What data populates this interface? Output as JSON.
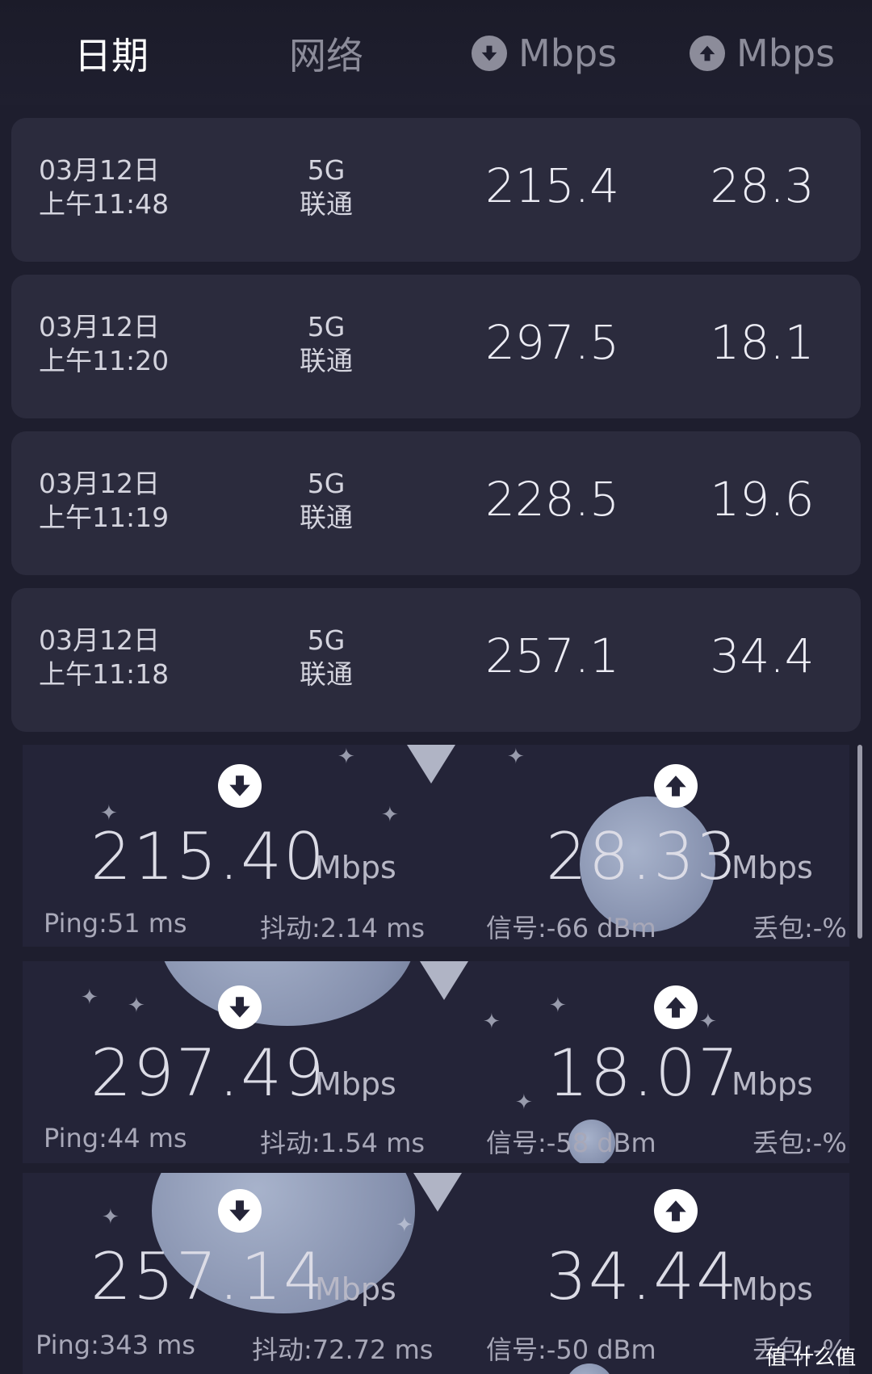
{
  "header": {
    "date_label": "日期",
    "network_label": "网络",
    "download_unit": "Mbps",
    "upload_unit": "Mbps"
  },
  "history": [
    {
      "date": "03月12日",
      "time": "上午11:48",
      "net_type": "5G",
      "carrier": "联通",
      "down": "215.4",
      "up": "28.3"
    },
    {
      "date": "03月12日",
      "time": "上午11:20",
      "net_type": "5G",
      "carrier": "联通",
      "down": "297.5",
      "up": "18.1"
    },
    {
      "date": "03月12日",
      "time": "上午11:19",
      "net_type": "5G",
      "carrier": "联通",
      "down": "228.5",
      "up": "19.6"
    },
    {
      "date": "03月12日",
      "time": "上午11:18",
      "net_type": "5G",
      "carrier": "联通",
      "down": "257.1",
      "up": "34.4"
    }
  ],
  "results": [
    {
      "down": "215.40",
      "up": "28.33",
      "unit": "Mbps",
      "ping": "Ping:51 ms",
      "jitter": "抖动:2.14 ms",
      "signal": "信号:-66 dBm",
      "loss": "丢包:-%"
    },
    {
      "down": "297.49",
      "up": "18.07",
      "unit": "Mbps",
      "ping": "Ping:44 ms",
      "jitter": "抖动:1.54 ms",
      "signal": "信号:-58 dBm",
      "loss": "丢包:-%"
    },
    {
      "down": "257.14",
      "up": "34.44",
      "unit": "Mbps",
      "ping": "Ping:343 ms",
      "jitter": "抖动:72.72 ms",
      "signal": "信号:-50 dBm",
      "loss": "丢包:-%"
    }
  ],
  "watermark": {
    "text": "值 什么值得买",
    "logo": "值"
  }
}
